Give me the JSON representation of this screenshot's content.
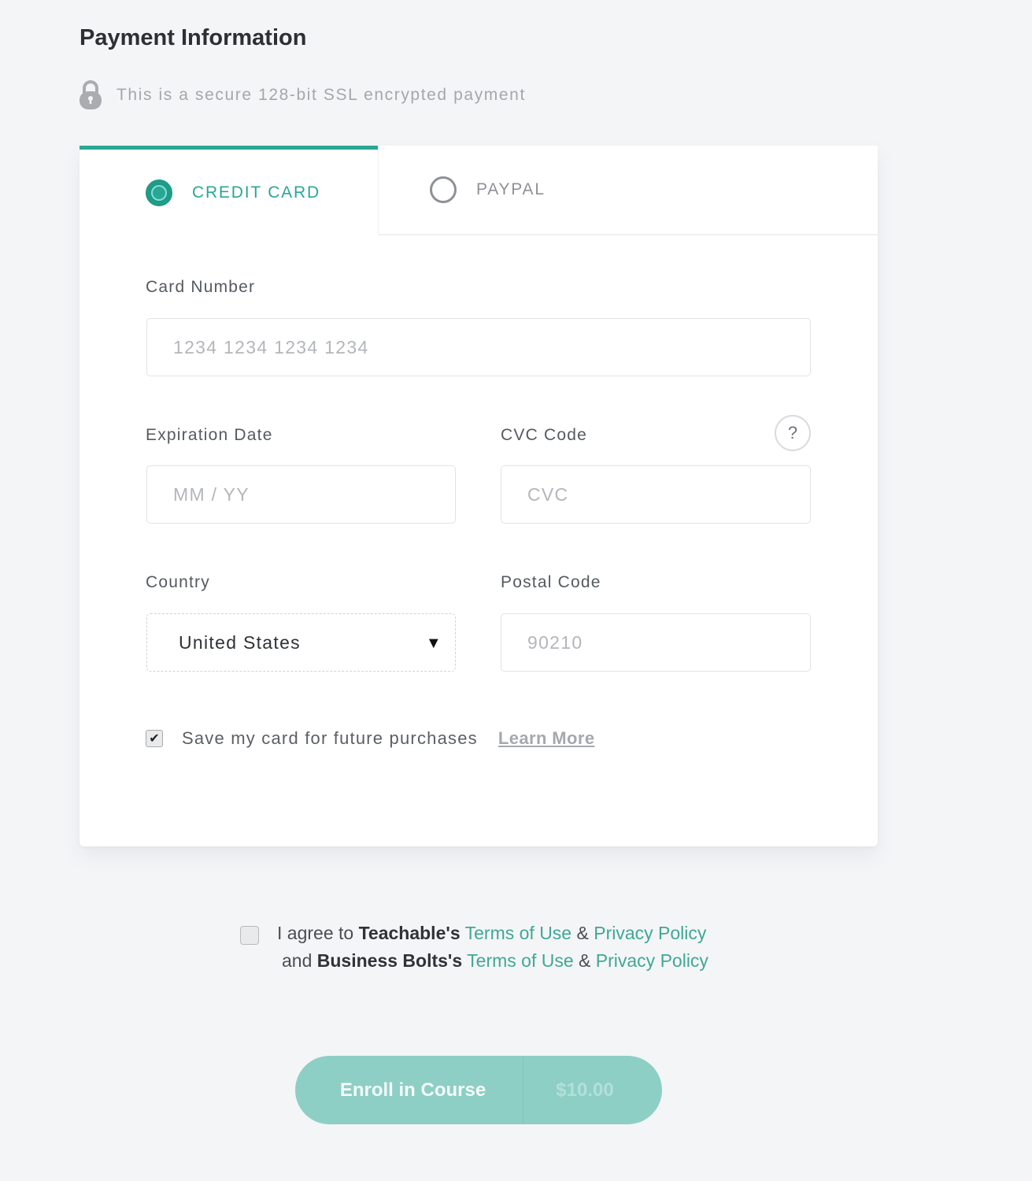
{
  "header": {
    "title": "Payment Information",
    "secure_icon": "lock-icon",
    "secure_text": "This is a secure 128-bit SSL encrypted payment"
  },
  "tabs": [
    {
      "label": "CREDIT CARD",
      "selected": true,
      "icon": "radio-checked-icon"
    },
    {
      "label": "PAYPAL",
      "selected": false,
      "icon": "radio-unchecked-icon"
    }
  ],
  "form": {
    "card_number": {
      "label": "Card Number",
      "placeholder": "1234 1234 1234 1234",
      "value": ""
    },
    "expiration": {
      "label": "Expiration Date",
      "placeholder": "MM / YY",
      "value": ""
    },
    "cvc": {
      "label": "CVC Code",
      "placeholder": "CVC",
      "value": "",
      "help_icon": "question-mark-icon",
      "help_glyph": "?"
    },
    "country": {
      "label": "Country",
      "selected": "United States",
      "caret": "▼"
    },
    "postal": {
      "label": "Postal Code",
      "placeholder": "90210",
      "value": ""
    },
    "save_card": {
      "label": "Save my card for future purchases",
      "checked": true,
      "check_glyph": "✔",
      "learn_more": "Learn More"
    }
  },
  "agreement": {
    "checked": false,
    "line1": {
      "prefix": "I agree to ",
      "org": "Teachable's",
      "terms": "Terms of Use",
      "amp": " & ",
      "privacy": "Privacy Policy"
    },
    "line2": {
      "prefix": "and ",
      "org": "Business Bolts's",
      "terms": "Terms of Use",
      "amp": " & ",
      "privacy": "Privacy Policy"
    }
  },
  "enroll": {
    "label": "Enroll in Course",
    "price": "$10.00"
  },
  "colors": {
    "accent": "#2aa794",
    "button": "#8dcfc5",
    "background": "#f4f5f7"
  }
}
